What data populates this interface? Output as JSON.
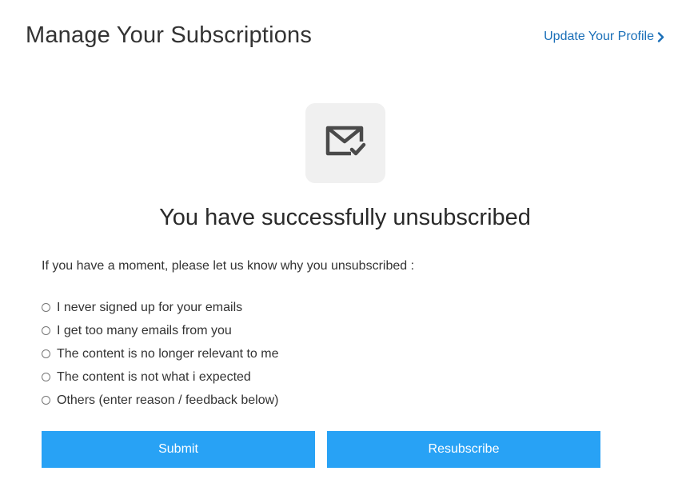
{
  "header": {
    "title": "Manage Your Subscriptions",
    "profile_link": "Update Your Profile"
  },
  "status": {
    "icon": "mail-check-icon",
    "headline": "You have successfully unsubscribed"
  },
  "survey": {
    "prompt": "If you have a moment, please let us know why you unsubscribed :",
    "options": [
      "I never signed up for your emails",
      "I get too many emails from you",
      "The content is no longer relevant to me",
      "The content is not what i expected",
      "Others (enter reason / feedback below)"
    ]
  },
  "actions": {
    "submit_label": "Submit",
    "resubscribe_label": "Resubscribe"
  },
  "colors": {
    "accent": "#28a2f5",
    "link": "#1a6fb8",
    "icon_box": "#f0f0f0"
  }
}
